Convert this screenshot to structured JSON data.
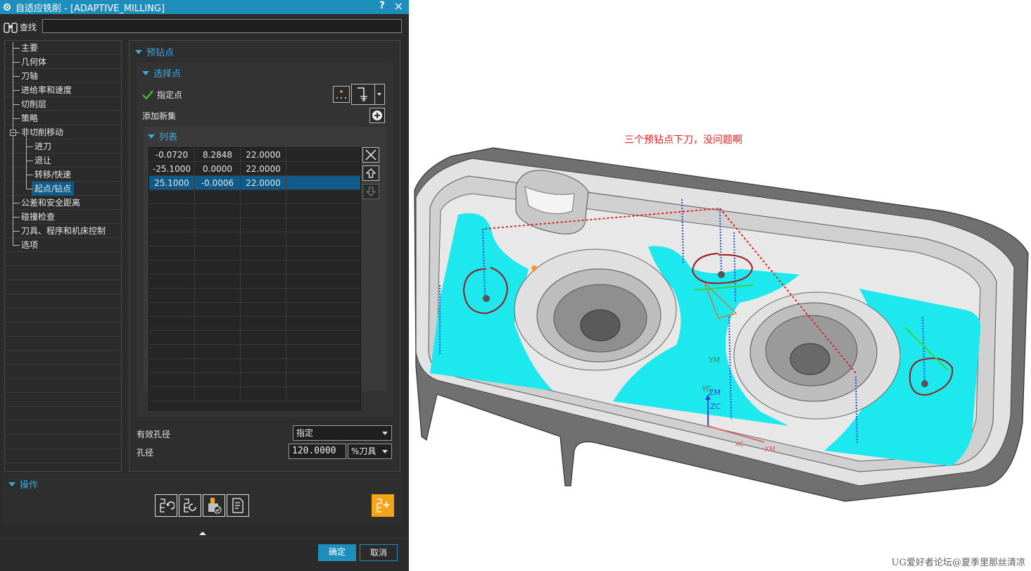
{
  "dialog": {
    "title": "自适应铣削 - [ADAPTIVE_MILLING]",
    "help_label": "?",
    "close_label": "×",
    "find_label": "查找",
    "find_value": ""
  },
  "tree": [
    {
      "label": "主要",
      "indent": 0
    },
    {
      "label": "几何体",
      "indent": 0
    },
    {
      "label": "刀轴",
      "indent": 0
    },
    {
      "label": "进给率和速度",
      "indent": 0
    },
    {
      "label": "切削层",
      "indent": 0
    },
    {
      "label": "策略",
      "indent": 0
    },
    {
      "label": "非切削移动",
      "indent": 0
    },
    {
      "label": "进刀",
      "indent": 1
    },
    {
      "label": "退让",
      "indent": 1
    },
    {
      "label": "转移/快速",
      "indent": 1
    },
    {
      "label": "起点/钻点",
      "indent": 1,
      "selected": true
    },
    {
      "label": "公差和安全距离",
      "indent": 0
    },
    {
      "label": "碰撞检查",
      "indent": 0
    },
    {
      "label": "刀具、程序和机床控制",
      "indent": 0
    },
    {
      "label": "选项",
      "indent": 0
    }
  ],
  "panel": {
    "group_predrill": "预钻点",
    "group_select_points": "选择点",
    "specify_points_label": "指定点",
    "add_new_set_label": "添加新集",
    "group_list": "列表",
    "list_rows": [
      [
        "-0.0720",
        "8.2848",
        "22.0000"
      ],
      [
        "-25.1000",
        "0.0000",
        "22.0000"
      ],
      [
        "25.1000",
        "-0.0006",
        "22.0000"
      ]
    ],
    "selected_row": 2,
    "effective_diameter_label": "有效孔径",
    "effective_diameter_value": "指定",
    "hole_diameter_label": "孔径",
    "hole_diameter_value": "120.0000",
    "hole_diameter_unit": "%刀具"
  },
  "operations": {
    "label": "操作"
  },
  "footer": {
    "ok_label": "确定",
    "cancel_label": "取消"
  },
  "viewport": {
    "annotation": "三个预钻点下刀，没问题啊",
    "axis_labels": [
      "YM",
      "YC",
      "ZM",
      "ZC",
      "XC",
      "XM"
    ],
    "watermark": "UG爱好者论坛@夏季里那丝清凉"
  },
  "colors": {
    "accent": "#1e8fbd",
    "selection": "#0f5c8a",
    "cyan_region": "#1de8ee",
    "annotation_red": "#e02020",
    "ops_highlight": "#f6a51a"
  }
}
